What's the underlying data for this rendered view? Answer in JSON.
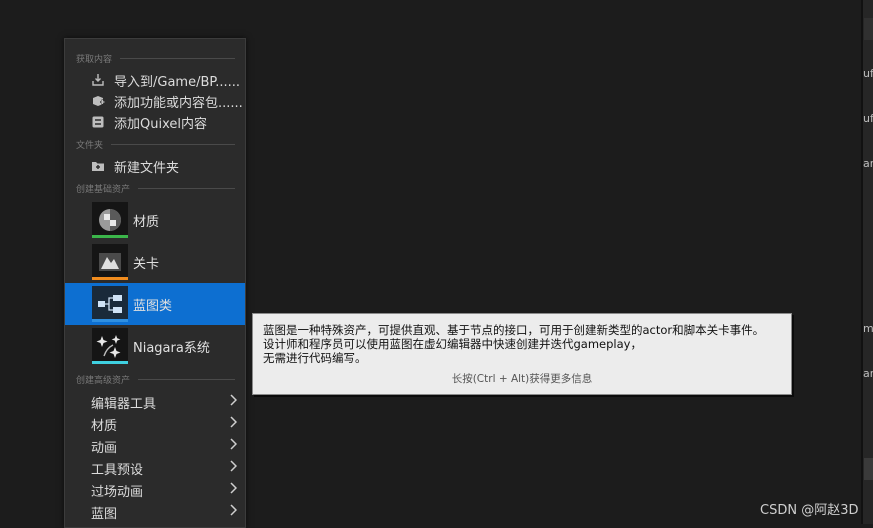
{
  "menu": {
    "sections": {
      "get_content": "获取内容",
      "folder": "文件夹",
      "create_basic": "创建基础资产",
      "create_advanced": "创建高级资产"
    },
    "get_content_items": [
      {
        "label": "导入到/Game/BP......",
        "icon": "import-icon"
      },
      {
        "label": "添加功能或内容包......",
        "icon": "feature-pack-icon"
      },
      {
        "label": "添加Quixel内容",
        "icon": "quixel-icon"
      }
    ],
    "folder_items": [
      {
        "label": "新建文件夹",
        "icon": "new-folder-icon"
      }
    ],
    "basic_assets": [
      {
        "label": "材质",
        "icon": "material-icon",
        "stripe": "#3bb54a"
      },
      {
        "label": "关卡",
        "icon": "level-icon",
        "stripe": "#f08c1e"
      },
      {
        "label": "蓝图类",
        "icon": "blueprint-icon",
        "stripe": "#2f8fe0",
        "selected": true
      },
      {
        "label": "Niagara系统",
        "icon": "niagara-icon",
        "stripe": "#3fd0e0"
      }
    ],
    "advanced_assets": [
      {
        "label": "编辑器工具"
      },
      {
        "label": "材质"
      },
      {
        "label": "动画"
      },
      {
        "label": "工具预设"
      },
      {
        "label": "过场动画"
      },
      {
        "label": "蓝图"
      }
    ]
  },
  "tooltip": {
    "line1": "蓝图是一种特殊资产，可提供直观、基于节点的接口，可用于创建新类型的actor和脚本关卡事件。",
    "line2": "设计师和程序员可以使用蓝图在虚幻编辑器中快速创建并迭代gameplay，",
    "line3": "无需进行代码编写。",
    "hint": "长按(Ctrl + Alt)获得更多信息"
  },
  "right_panel_fragments": [
    "uf",
    "uf",
    "ar",
    "m",
    "ar"
  ],
  "watermark": "CSDN @阿赵3D",
  "colors": {
    "selected": "#0d6fd1",
    "material_stripe": "#3bb54a",
    "level_stripe": "#f08c1e",
    "blueprint_stripe": "#2f8fe0",
    "niagara_stripe": "#3fd0e0"
  }
}
